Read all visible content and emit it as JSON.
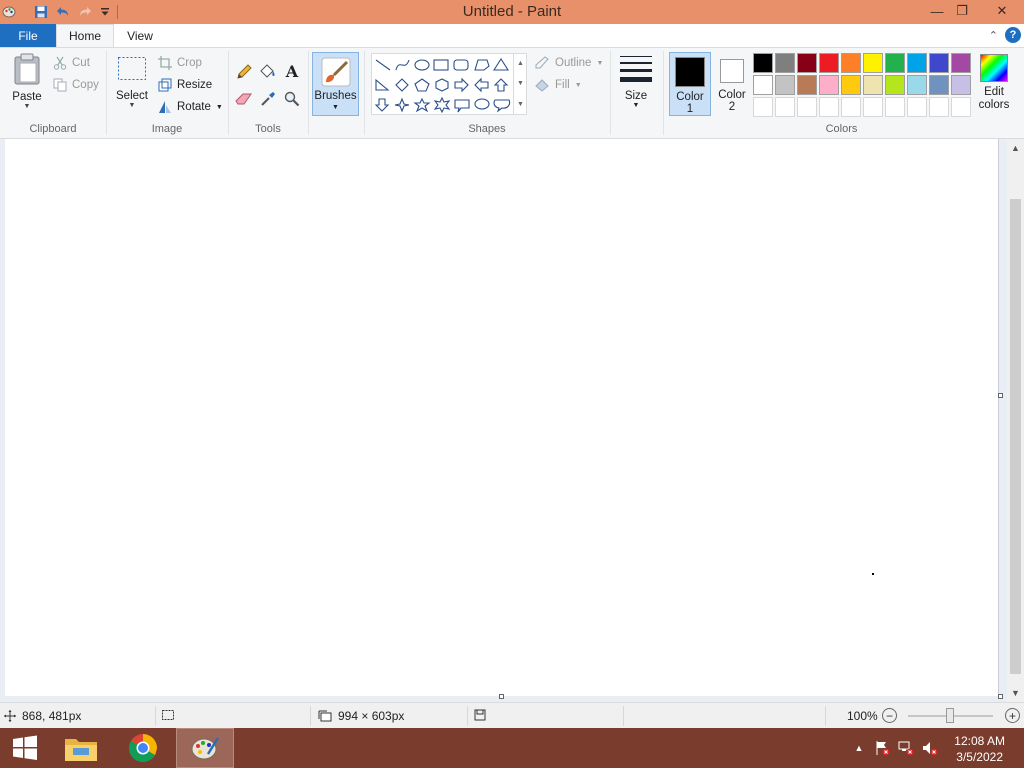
{
  "window": {
    "title": "Untitled - Paint",
    "minimize": "—",
    "restore": "❐",
    "close": "✕"
  },
  "tabs": {
    "file": "File",
    "home": "Home",
    "view": "View",
    "help": "?"
  },
  "ribbon": {
    "clipboard": {
      "label": "Clipboard",
      "paste": "Paste",
      "cut": "Cut",
      "copy": "Copy"
    },
    "image": {
      "label": "Image",
      "select": "Select",
      "crop": "Crop",
      "resize": "Resize",
      "rotate": "Rotate"
    },
    "tools": {
      "label": "Tools"
    },
    "brushes": {
      "label": "Brushes"
    },
    "shapes": {
      "label": "Shapes",
      "outline": "Outline",
      "fill": "Fill"
    },
    "size": {
      "label": "Size"
    },
    "colors": {
      "label": "Colors",
      "color1": "Color",
      "color1_num": "1",
      "color2": "Color",
      "color2_num": "2",
      "edit": "Edit",
      "edit2": "colors",
      "color1_value": "#000000",
      "color2_value": "#ffffff",
      "palette_row1": [
        "#000000",
        "#7f7f7f",
        "#880015",
        "#ed1c24",
        "#ff7f27",
        "#fff200",
        "#22b14c",
        "#00a2e8",
        "#3f48cc",
        "#a349a4"
      ],
      "palette_row2": [
        "#ffffff",
        "#c3c3c3",
        "#b97a57",
        "#ffaec9",
        "#ffc90e",
        "#efe4b0",
        "#b5e61d",
        "#99d9ea",
        "#7092be",
        "#c8bfe7"
      ]
    }
  },
  "status": {
    "cursor_pos": "868, 481px",
    "canvas_size": "994 × 603px",
    "zoom": "100%"
  },
  "clock": {
    "time": "12:08 AM",
    "date": "3/5/2022"
  }
}
